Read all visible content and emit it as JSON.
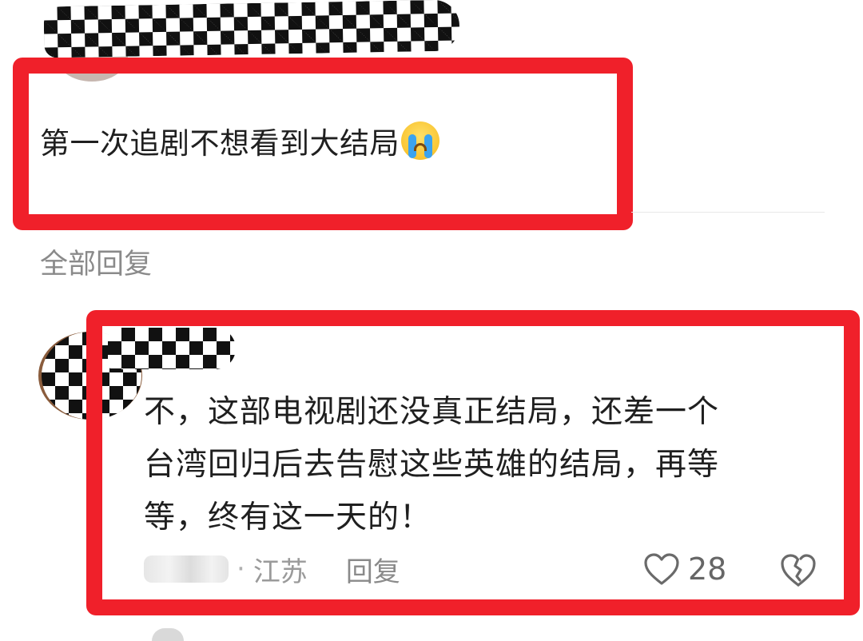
{
  "comment1": {
    "text": "第一次追剧不想看到大结局"
  },
  "all_replies_label": "全部回复",
  "comment2": {
    "text": "不，这部电视剧还没真正结局，还差一个\n台湾回归后去告慰这些英雄的结局，再等\n等，终有这一天的！",
    "location_separator": "·",
    "location": "江苏",
    "reply_label": "回复",
    "like_count": "28"
  },
  "colors": {
    "highlight_red": "#f0202a",
    "muted_text": "#8a8a8a"
  },
  "icons": {
    "emoji": "loudly-crying-face",
    "like": "heart-outline-icon",
    "dislike": "broken-heart-icon"
  }
}
